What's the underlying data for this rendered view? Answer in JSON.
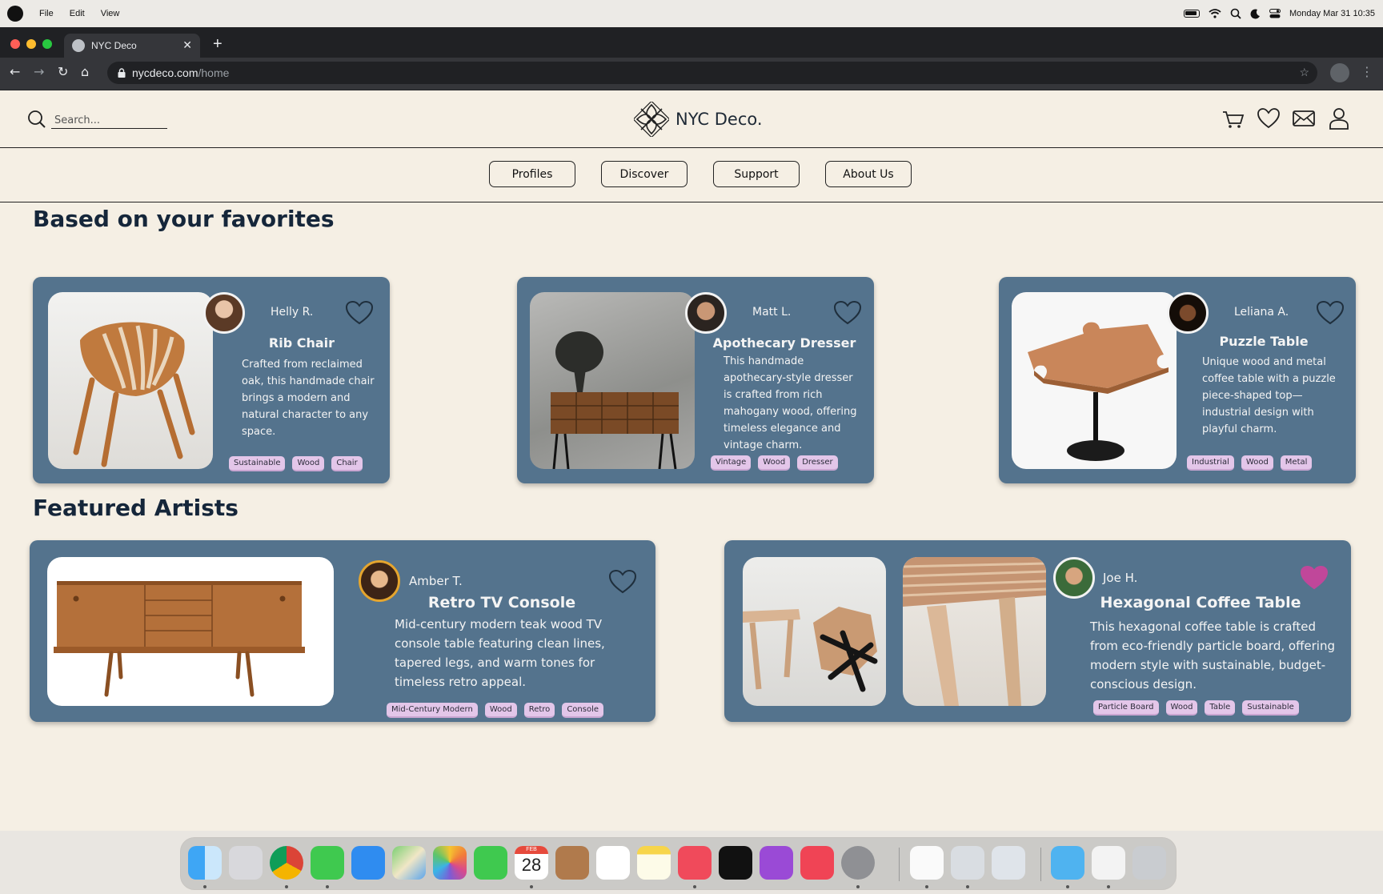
{
  "menubar": {
    "menus": [
      "File",
      "Edit",
      "View"
    ],
    "datetime": "Monday Mar 31  10:35"
  },
  "browser": {
    "tab_title": "NYC Deco",
    "url_host": "nycdeco.com",
    "url_path": "/home"
  },
  "header": {
    "search_placeholder": "Search...",
    "logo_text": "NYC Deco."
  },
  "nav": {
    "items": [
      "Profiles",
      "Discover",
      "Support",
      "About Us"
    ]
  },
  "favorites": {
    "title": "Based on your favorites",
    "cards": [
      {
        "artist": "Helly R.",
        "title": "Rib Chair",
        "desc": "Crafted from reclaimed oak, this handmade chair brings a modern and natural character to any space.",
        "tags": [
          "Sustainable",
          "Wood",
          "Chair"
        ],
        "liked": false
      },
      {
        "artist": "Matt L.",
        "title": "Apothecary Dresser",
        "desc": "This handmade apothecary-style dresser is crafted from rich mahogany wood, offering timeless elegance and vintage charm.",
        "tags": [
          "Vintage",
          "Wood",
          "Dresser"
        ],
        "liked": false
      },
      {
        "artist": "Leliana A.",
        "title": "Puzzle Table",
        "desc": "Unique wood and metal coffee table with a puzzle piece-shaped top—industrial design with playful charm.",
        "tags": [
          "Industrial",
          "Wood",
          "Metal"
        ],
        "liked": false
      }
    ]
  },
  "featured": {
    "title": "Featured Artists",
    "cards": [
      {
        "artist": "Amber T.",
        "title": "Retro TV Console",
        "desc": "Mid-century modern teak wood TV console table featuring clean lines, tapered legs, and warm tones for timeless retro appeal.",
        "tags": [
          "Mid-Century Modern",
          "Wood",
          "Retro",
          "Console"
        ],
        "liked": false
      },
      {
        "artist": "Joe H.",
        "title": "Hexagonal Coffee Table",
        "desc": "This hexagonal coffee table is crafted from eco-friendly particle board, offering modern style with sustainable, budget-conscious design.",
        "tags": [
          "Particle Board",
          "Wood",
          "Table",
          "Sustainable"
        ],
        "liked": true
      }
    ]
  },
  "colors": {
    "card_bg": "#54738d",
    "page_bg": "#f5efe4",
    "tag_bg": "#e3c6e9",
    "liked_heart": "#c0479a"
  },
  "dock": {
    "calendar_month": "FEB",
    "calendar_day": "28",
    "apps": [
      "finder-icon",
      "launchpad-icon",
      "chrome-icon",
      "messages-icon",
      "mail-icon",
      "maps-icon",
      "photos-icon",
      "facetime-icon",
      "calendar-icon",
      "contacts-icon",
      "reminders-icon",
      "notes-icon",
      "music-icon",
      "tv-icon",
      "podcasts-icon",
      "news-icon",
      "settings-icon",
      "textedit-icon",
      "preview-icon",
      "blank-icon",
      "folder-icon",
      "document-icon",
      "trash-icon"
    ]
  }
}
